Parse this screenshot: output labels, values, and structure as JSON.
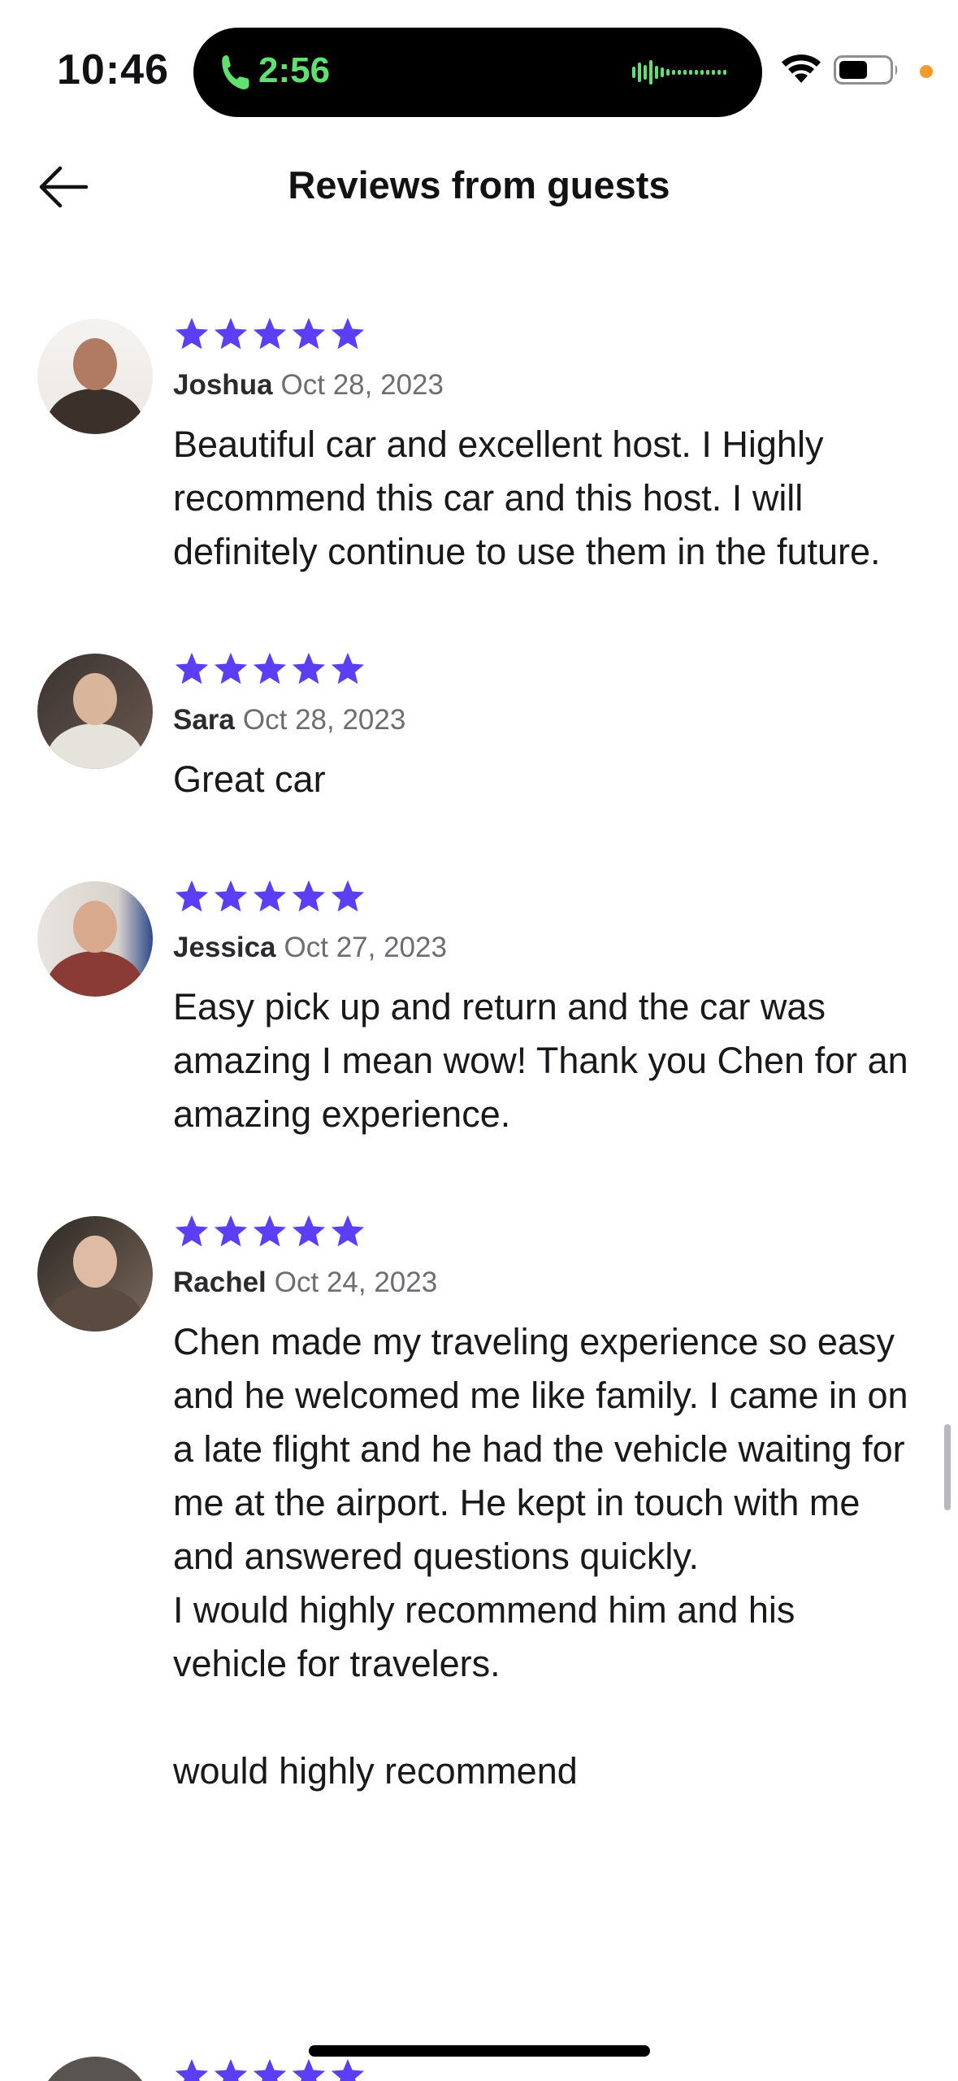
{
  "status_bar": {
    "time": "10:46",
    "call_duration": "2:56"
  },
  "header": {
    "title": "Reviews from guests"
  },
  "colors": {
    "star": "#5b3ef5",
    "call_green": "#5fe06f"
  },
  "reviews": [
    {
      "name": "Joshua",
      "date": "Oct 28, 2023",
      "rating": 5,
      "text": "Beautiful car and excellent host.  I Highly recommend this car and this host.  I will definitely continue to use them in the future."
    },
    {
      "name": "Sara",
      "date": "Oct 28, 2023",
      "rating": 5,
      "text": "Great car"
    },
    {
      "name": "Jessica",
      "date": "Oct 27, 2023",
      "rating": 5,
      "text": "Easy pick up and return and the car was amazing I mean wow! Thank you Chen for an amazing experience."
    },
    {
      "name": "Rachel",
      "date": "Oct 24, 2023",
      "rating": 5,
      "text": "Chen made my traveling experience so easy and he welcomed me like family. I came in on a late flight and he had the vehicle waiting for me at the airport. He kept in touch with me and answered questions quickly.\nI would highly recommend him and his vehicle for travelers.\n\nwould highly recommend"
    }
  ],
  "next_review": {
    "rating": 5
  }
}
